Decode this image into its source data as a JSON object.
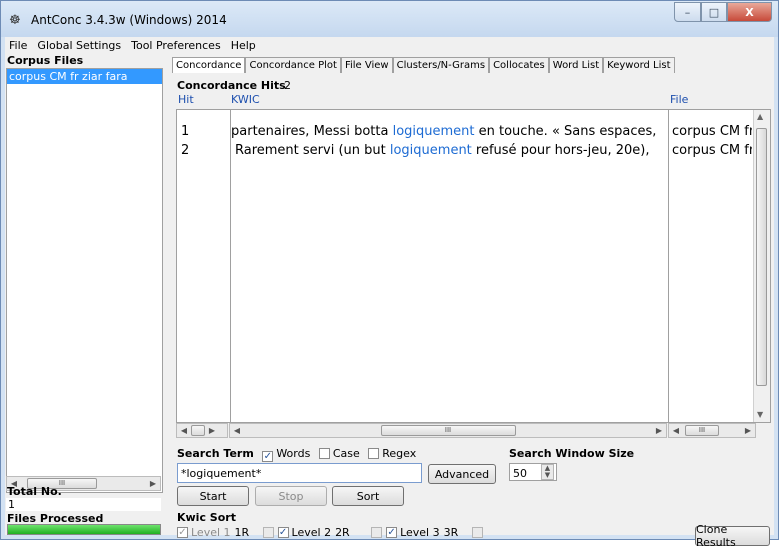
{
  "window": {
    "title": "AntConc 3.4.3w (Windows) 2014",
    "icon": "antconc-app-icon",
    "min_label": "–",
    "max_label": "□",
    "close_label": "X"
  },
  "menu": [
    "File",
    "Global Settings",
    "Tool Preferences",
    "Help"
  ],
  "left_panel": {
    "corpus_files_label": "Corpus Files",
    "files": [
      "corpus CM fr ziar fara"
    ],
    "total_label": "Total No.",
    "total_value": "1",
    "files_processed_label": "Files Processed",
    "progress": 1.0
  },
  "tabs": [
    "Concordance",
    "Concordance Plot",
    "File View",
    "Clusters/N-Grams",
    "Collocates",
    "Word List",
    "Keyword List"
  ],
  "active_tab": "Concordance",
  "concordance": {
    "hits_label": "Concordance Hits",
    "hits_count": "2",
    "headers": {
      "hit": "Hit",
      "kwic": "KWIC",
      "file": "File"
    },
    "rows": [
      {
        "hit": "1",
        "left": "partenaires, Messi botta ",
        "keyword": "logiquement",
        "right": " en touche. « Sans espaces,",
        "file": "corpus CM fr"
      },
      {
        "hit": "2",
        "left": "Rarement servi (un but ",
        "keyword": "logiquement",
        "right": " refusé pour hors-jeu, 20e),",
        "file": "corpus CM fr"
      }
    ]
  },
  "search": {
    "term_label": "Search Term",
    "words_label": "Words",
    "case_label": "Case",
    "regex_label": "Regex",
    "words_checked": true,
    "case_checked": false,
    "regex_checked": false,
    "value": "*logiquement*",
    "advanced_label": "Advanced",
    "window_size_label": "Search Window Size",
    "window_size_value": "50"
  },
  "buttons": {
    "start": "Start",
    "stop": "Stop",
    "sort": "Sort",
    "clone": "Clone Results"
  },
  "kwic_sort": {
    "label": "Kwic Sort",
    "levels": [
      {
        "label": "Level 1",
        "value": "1R",
        "checked": true
      },
      {
        "label": "Level 2",
        "value": "2R",
        "checked": true
      },
      {
        "label": "Level 3",
        "value": "3R",
        "checked": true
      }
    ]
  },
  "scroll": {
    "dots": "III",
    "left_arrow": "◀",
    "right_arrow": "▶",
    "up_arrow": "▲",
    "down_arrow": "▼"
  },
  "check_mark": "✓"
}
